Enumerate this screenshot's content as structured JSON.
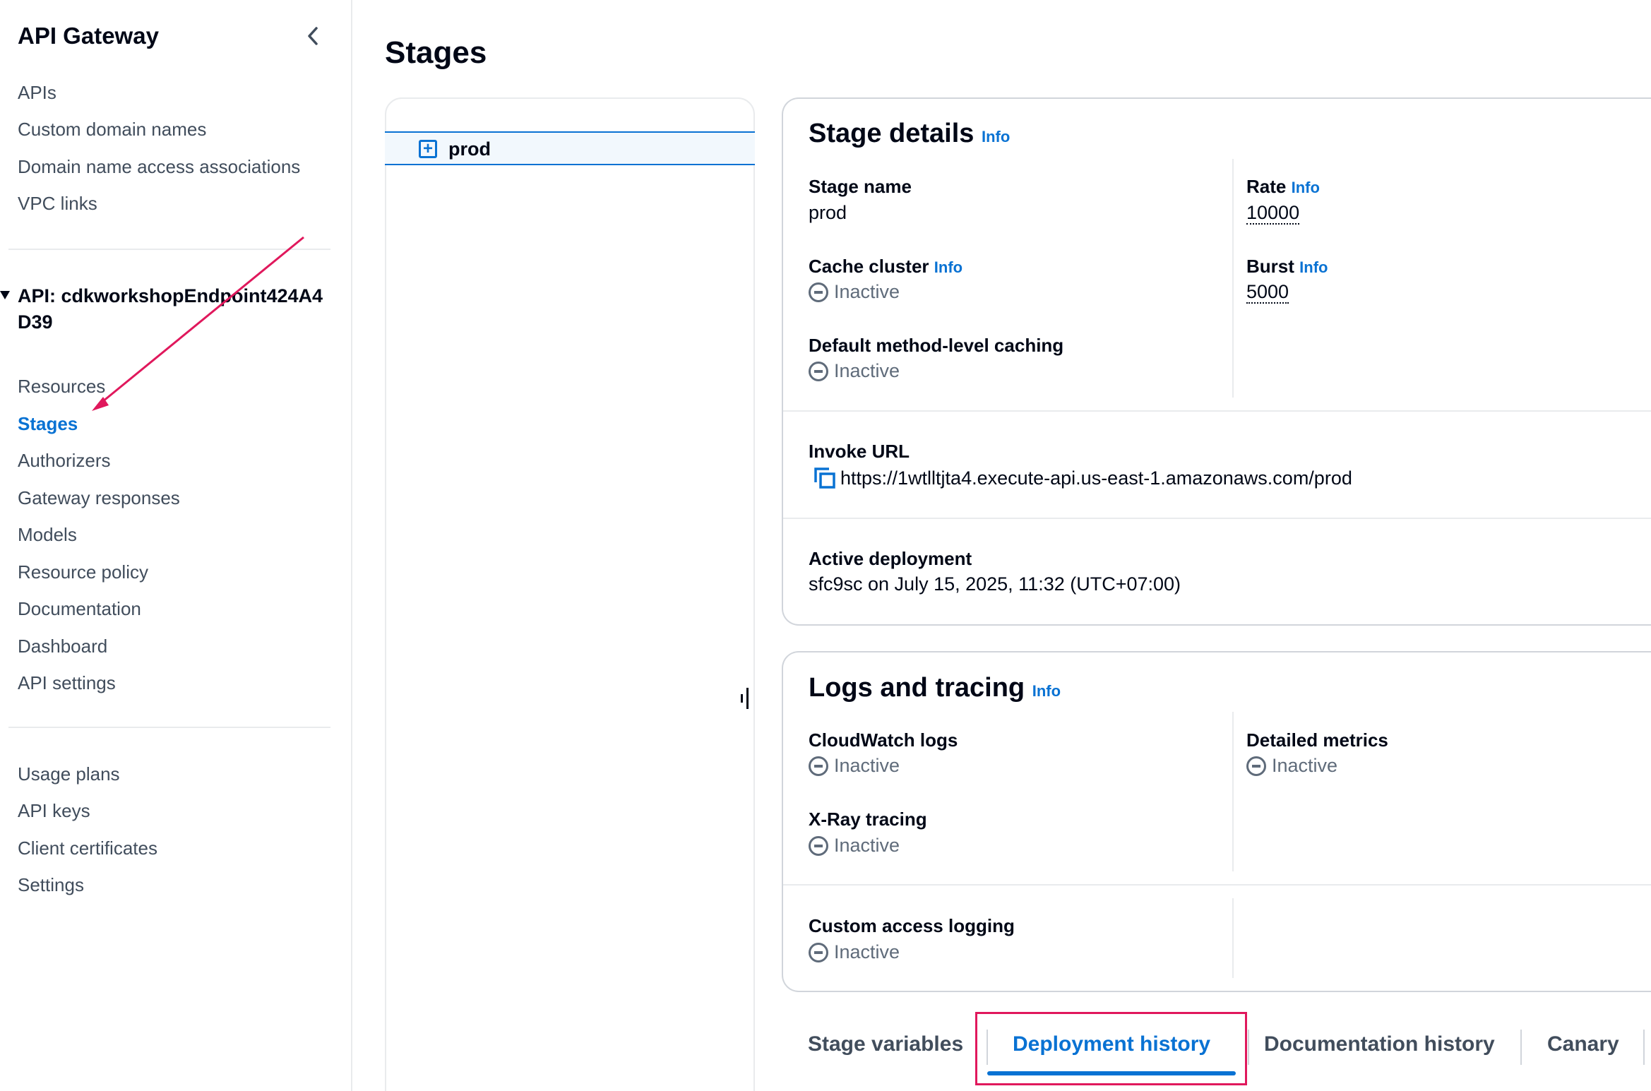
{
  "sidebar": {
    "title": "API Gateway",
    "top_items": [
      {
        "label": "APIs"
      },
      {
        "label": "Custom domain names"
      },
      {
        "label": "Domain name access associations"
      },
      {
        "label": "VPC links"
      }
    ],
    "api_header": "API: cdkworkshopEndpoint424A4D39",
    "api_items": [
      {
        "label": "Resources"
      },
      {
        "label": "Stages",
        "active": true
      },
      {
        "label": "Authorizers"
      },
      {
        "label": "Gateway responses"
      },
      {
        "label": "Models"
      },
      {
        "label": "Resource policy"
      },
      {
        "label": "Documentation"
      },
      {
        "label": "Dashboard"
      },
      {
        "label": "API settings"
      }
    ],
    "bottom_items": [
      {
        "label": "Usage plans"
      },
      {
        "label": "API keys"
      },
      {
        "label": "Client certificates"
      },
      {
        "label": "Settings"
      }
    ]
  },
  "page_title": "Stages",
  "tree": {
    "stage": "prod",
    "expand_symbol": "+"
  },
  "stage_details": {
    "title": "Stage details",
    "info": "Info",
    "stage_name_label": "Stage name",
    "stage_name": "prod",
    "cache_cluster_label": "Cache cluster",
    "cache_cluster_status": "Inactive",
    "default_caching_label": "Default method-level caching",
    "default_caching_status": "Inactive",
    "rate_label": "Rate",
    "rate": "10000",
    "burst_label": "Burst",
    "burst": "5000",
    "invoke_url_label": "Invoke URL",
    "invoke_url": "https://1wtlltjta4.execute-api.us-east-1.amazonaws.com/prod",
    "active_deployment_label": "Active deployment",
    "active_deployment": "sfc9sc on July 15, 2025, 11:32 (UTC+07:00)"
  },
  "logs_tracing": {
    "title": "Logs and tracing",
    "info": "Info",
    "cloudwatch_label": "CloudWatch logs",
    "cloudwatch_status": "Inactive",
    "detailed_metrics_label": "Detailed metrics",
    "detailed_metrics_status": "Inactive",
    "xray_label": "X-Ray tracing",
    "xray_status": "Inactive",
    "custom_access_label": "Custom access logging",
    "custom_access_status": "Inactive"
  },
  "tabs": [
    {
      "label": "Stage variables"
    },
    {
      "label": "Deployment history",
      "active": true
    },
    {
      "label": "Documentation history"
    },
    {
      "label": "Canary"
    }
  ],
  "colors": {
    "accent": "#0972d3",
    "annotation": "#e0185c",
    "inactive": "#5f6b7a"
  }
}
